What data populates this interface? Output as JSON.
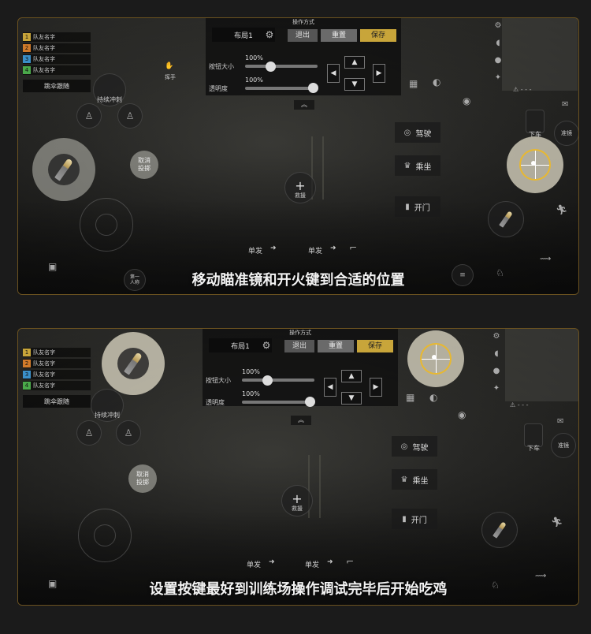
{
  "panels": [
    {
      "teammates": [
        "队友名字",
        "队友名字",
        "队友名字",
        "队友名字"
      ],
      "teammate_numbers": [
        "1",
        "2",
        "3",
        "4"
      ],
      "follow_label": "跳伞跟随",
      "sprint_label": "持续冲刺",
      "cancel_label": "取消\n投掷",
      "rescue_label": "救援",
      "wave_label": "挥手",
      "ops": {
        "title": "操作方式",
        "layout": "布局1",
        "exit": "退出",
        "reset": "重置",
        "save": "保存",
        "size_label": "按钮大小",
        "size_value": "100%",
        "opacity_label": "透明度",
        "opacity_value": "100%"
      },
      "actions": [
        "驾驶",
        "乘坐",
        "开门"
      ],
      "exit_vehicle": "下车",
      "aim_label": "准镜",
      "fire_left": "单发",
      "fire_right": "单发",
      "first_person": "第一\n人称",
      "caption": "移动瞄准镜和开火键到合适的位置"
    },
    {
      "teammates": [
        "队友名字",
        "队友名字",
        "队友名字",
        "队友名字"
      ],
      "teammate_numbers": [
        "1",
        "2",
        "3",
        "4"
      ],
      "follow_label": "跳伞跟随",
      "sprint_label": "持续冲刺",
      "cancel_label": "取消\n投掷",
      "rescue_label": "救援",
      "ops": {
        "title": "操作方式",
        "layout": "布局1",
        "exit": "退出",
        "reset": "重置",
        "save": "保存",
        "size_label": "按钮大小",
        "size_value": "100%",
        "opacity_label": "透明度",
        "opacity_value": "100%"
      },
      "actions": [
        "驾驶",
        "乘坐",
        "开门"
      ],
      "exit_vehicle": "下车",
      "aim_label": "准镜",
      "fire_left": "单发",
      "fire_right": "单发",
      "caption": "设置按键最好到训练场操作调试完毕后开始吃鸡"
    }
  ],
  "colors": {
    "accent_gold": "#c8a53a",
    "teammate_num": [
      "#c8a53a",
      "#d07a2a",
      "#3a8fc8",
      "#4aa84a"
    ],
    "frame": "#6b5220"
  }
}
